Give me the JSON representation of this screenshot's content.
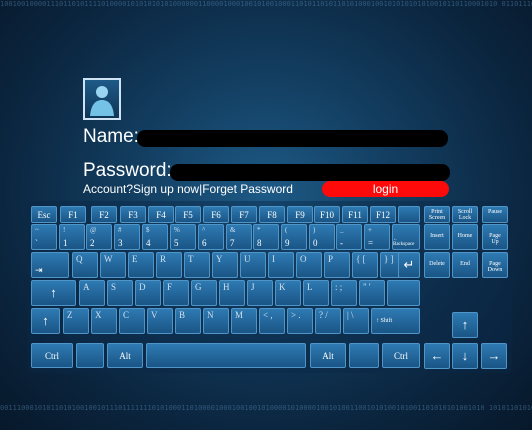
{
  "binary": {
    "top": "1001001000011101101011110100001010101010100000011000010001001010010001101011010110101000100101010101010010110110001010 0110111010100001101110001000101001010001011100010100000101011110101000100010101001010011001000010110101001001",
    "bottom": "0011100010101101010010010111011111110101000110100001000100100101000010100001001010011001010100101001101010101001010 1010110101011111001100001000101101011111001011010110100000101101010101011001010101000011111010110011001010010"
  },
  "form": {
    "name_label": "Name:",
    "password_label": "Password:",
    "account_question": "Account?",
    "sign_up_link": "Sign up now",
    "separator": "|",
    "forgot_link": "Forget Password",
    "login_button": "login"
  },
  "keyboard": {
    "fn_row": [
      "Esc",
      "F1",
      "F2",
      "F3",
      "F4",
      "F5",
      "F6",
      "F7",
      "F8",
      "F9",
      "F10",
      "F11",
      "F12"
    ],
    "nav_fn": [
      {
        "top": "Print",
        "bottom": "Screen"
      },
      {
        "top": "Scroll",
        "bottom": "Lock"
      },
      {
        "top": "",
        "bottom": "Pause"
      }
    ],
    "number_row": [
      {
        "top": "~",
        "bot": "`"
      },
      {
        "top": "!",
        "bot": "1"
      },
      {
        "top": "@",
        "bot": "2"
      },
      {
        "top": "#",
        "bot": "3"
      },
      {
        "top": "$",
        "bot": "4"
      },
      {
        "top": "%",
        "bot": "5"
      },
      {
        "top": "^",
        "bot": "6"
      },
      {
        "top": "&",
        "bot": "7"
      },
      {
        "top": "*",
        "bot": "8"
      },
      {
        "top": "(",
        "bot": "9"
      },
      {
        "top": ")",
        "bot": "0"
      },
      {
        "top": "_",
        "bot": "-"
      },
      {
        "top": "+",
        "bot": "="
      }
    ],
    "backspace": "Backspace",
    "nav_row2": [
      {
        "top": "",
        "bottom": "Insert"
      },
      {
        "top": "",
        "bottom": "Home"
      },
      {
        "top": "Page",
        "bottom": "Up"
      }
    ],
    "qwerty": [
      "Q",
      "W",
      "E",
      "R",
      "T",
      "Y",
      "U",
      "I",
      "O",
      "P",
      "{ [",
      "} ]"
    ],
    "nav_row3": [
      {
        "top": "",
        "bottom": "Delete"
      },
      {
        "top": "",
        "bottom": "End"
      },
      {
        "top": "Page",
        "bottom": "Down"
      }
    ],
    "asdf": [
      "A",
      "S",
      "D",
      "F",
      "G",
      "H",
      "J",
      "K",
      "L",
      ": ;",
      "\" '"
    ],
    "zxcv": [
      "Z",
      "X",
      "C",
      "V",
      "B",
      "N",
      "M",
      "< ,",
      "> .",
      "? /",
      "| \\"
    ],
    "shift": "Shift",
    "ctrl_left": "Ctrl",
    "alt_left": "Alt",
    "alt_right": "Alt",
    "ctrl_right": "Ctrl"
  }
}
